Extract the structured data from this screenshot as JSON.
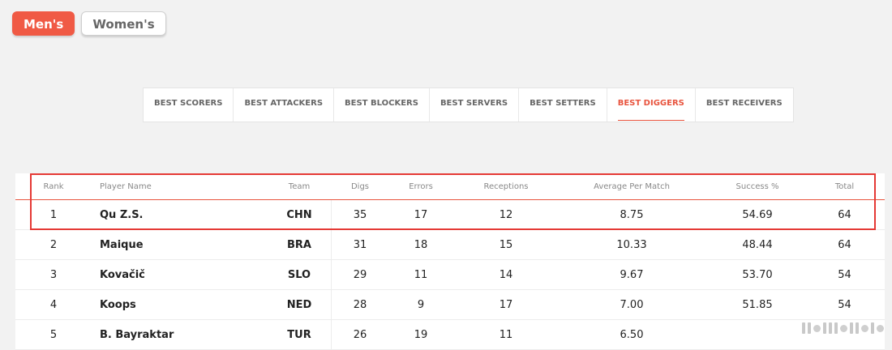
{
  "gender": {
    "options": [
      {
        "label": "Men's",
        "active": true
      },
      {
        "label": "Women's",
        "active": false
      }
    ]
  },
  "tabs": [
    {
      "label": "BEST SCORERS",
      "active": false
    },
    {
      "label": "BEST ATTACKERS",
      "active": false
    },
    {
      "label": "BEST BLOCKERS",
      "active": false
    },
    {
      "label": "BEST SERVERS",
      "active": false
    },
    {
      "label": "BEST SETTERS",
      "active": false
    },
    {
      "label": "BEST DIGGERS",
      "active": true
    },
    {
      "label": "BEST RECEIVERS",
      "active": false
    }
  ],
  "table": {
    "headers": {
      "rank": "Rank",
      "player": "Player Name",
      "team": "Team",
      "digs": "Digs",
      "errors": "Errors",
      "receptions": "Receptions",
      "average": "Average Per Match",
      "success": "Success %",
      "total": "Total"
    },
    "rows": [
      {
        "rank": "1",
        "player": "Qu Z.S.",
        "team": "CHN",
        "digs": "35",
        "errors": "17",
        "receptions": "12",
        "average": "8.75",
        "success": "54.69",
        "total": "64"
      },
      {
        "rank": "2",
        "player": "Maique",
        "team": "BRA",
        "digs": "31",
        "errors": "18",
        "receptions": "15",
        "average": "10.33",
        "success": "48.44",
        "total": "64"
      },
      {
        "rank": "3",
        "player": "Kovačič",
        "team": "SLO",
        "digs": "29",
        "errors": "11",
        "receptions": "14",
        "average": "9.67",
        "success": "53.70",
        "total": "54"
      },
      {
        "rank": "4",
        "player": "Koops",
        "team": "NED",
        "digs": "28",
        "errors": "9",
        "receptions": "17",
        "average": "7.00",
        "success": "51.85",
        "total": "54"
      },
      {
        "rank": "5",
        "player": "B. Bayraktar",
        "team": "TUR",
        "digs": "26",
        "errors": "19",
        "receptions": "11",
        "average": "6.50",
        "success": "",
        "total": ""
      }
    ]
  },
  "colors": {
    "accent": "#f05a45",
    "highlight_box": "#e53935"
  }
}
